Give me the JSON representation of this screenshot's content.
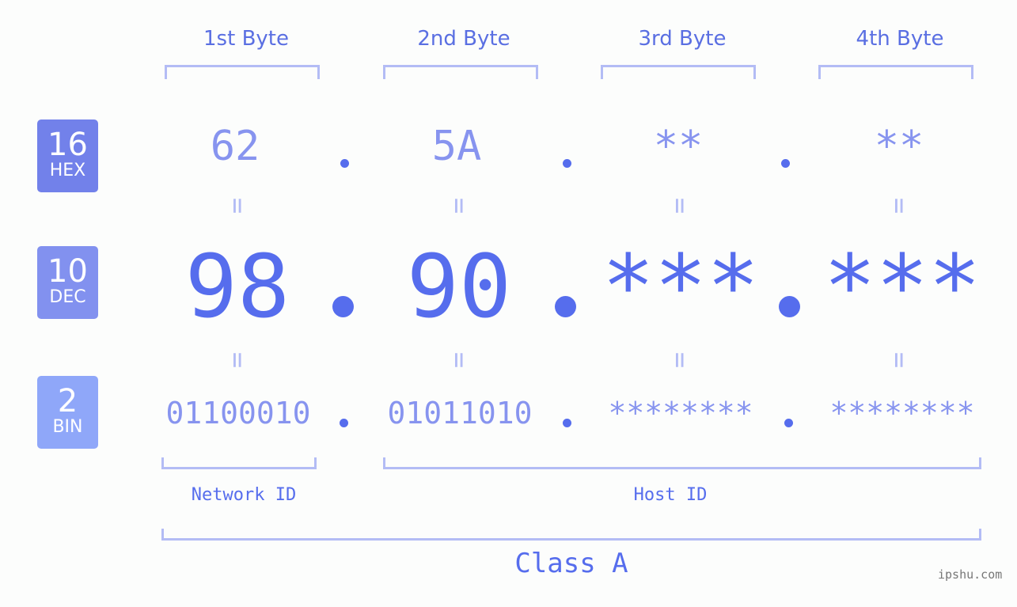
{
  "bases": [
    {
      "num": "16",
      "label": "HEX",
      "color": "#7281ea"
    },
    {
      "num": "10",
      "label": "DEC",
      "color": "#8291ef"
    },
    {
      "num": "2",
      "label": "BIN",
      "color": "#8fa7f9"
    }
  ],
  "byte_headers": [
    "1st Byte",
    "2nd Byte",
    "3rd Byte",
    "4th Byte"
  ],
  "hex": [
    "62",
    "5A",
    "**",
    "**"
  ],
  "dec": [
    "98",
    "90",
    "***",
    "***"
  ],
  "bin": [
    "01100010",
    "01011010",
    "********",
    "********"
  ],
  "equals_sign": "=",
  "network_label": "Network ID",
  "host_label": "Host ID",
  "class_label": "Class A",
  "watermark": "ipshu.com",
  "colors": {
    "accent": "#566ded",
    "light": "#8794ef",
    "bracket": "#b3bcf5"
  }
}
